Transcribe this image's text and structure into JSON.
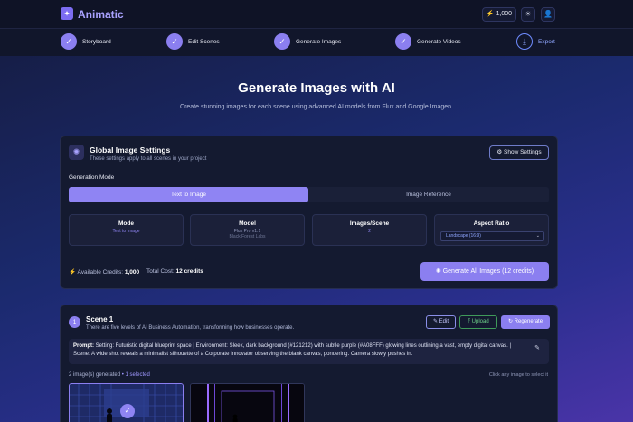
{
  "app": {
    "title": "Animatic",
    "logo_icon": "sparkle-icon"
  },
  "header": {
    "credits": "1,000"
  },
  "steps": [
    {
      "label": "Storyboard",
      "done": true
    },
    {
      "label": "Edit Scenes",
      "done": true
    },
    {
      "label": "Generate Images",
      "done": true
    },
    {
      "label": "Generate Videos",
      "done": true
    },
    {
      "label": "Export",
      "done": false
    }
  ],
  "page": {
    "title": "Generate Images with AI",
    "subtitle": "Create stunning images for each scene using advanced AI models from Flux and Google Imagen."
  },
  "global_settings": {
    "title": "Global Image Settings",
    "subtitle": "These settings apply to all scenes in your project",
    "show_settings": "Show Settings",
    "generation_mode_label": "Generation Mode",
    "tabs": [
      "Text to Image",
      "Image Reference"
    ],
    "active_tab": 0,
    "mode": {
      "label": "Mode",
      "value": "Text to Image"
    },
    "model": {
      "label": "Model",
      "value": "Flux Pro v1.1",
      "vendor": "Black Forest Labs"
    },
    "images_per_scene": {
      "label": "Images/Scene",
      "value": "2"
    },
    "aspect_ratio": {
      "label": "Aspect Ratio",
      "value": "Landscape (16:9)"
    },
    "available_credits_label": "Available Credits:",
    "available_credits": "1,000",
    "total_cost_label": "Total Cost:",
    "total_cost": "12 credits",
    "generate_all": "Generate All Images (12 credits)"
  },
  "scene": {
    "number": "1",
    "title": "Scene 1",
    "description": "There are five levels of AI Business Automation, transforming how businesses operate.",
    "edit": "Edit",
    "upload": "Upload",
    "regenerate": "Regenerate",
    "prompt_label": "Prompt:",
    "prompt": "Setting: Futuristic digital blueprint space | Environment: Sleek, dark background (#121212) with subtle purple (#A08FFF) glowing lines outlining a vast, empty digital canvas. | Scene: A wide shot reveals a minimalist silhouette of a Corporate Innovator observing the blank canvas, pondering. Camera slowly pushes in.",
    "generated": "2 image(s) generated",
    "selected": "• 1 selected",
    "hint": "Click any image to select it"
  },
  "colors": {
    "accent": "#8b7ff0",
    "bg_dark": "#0f1326",
    "card": "#141a30"
  }
}
